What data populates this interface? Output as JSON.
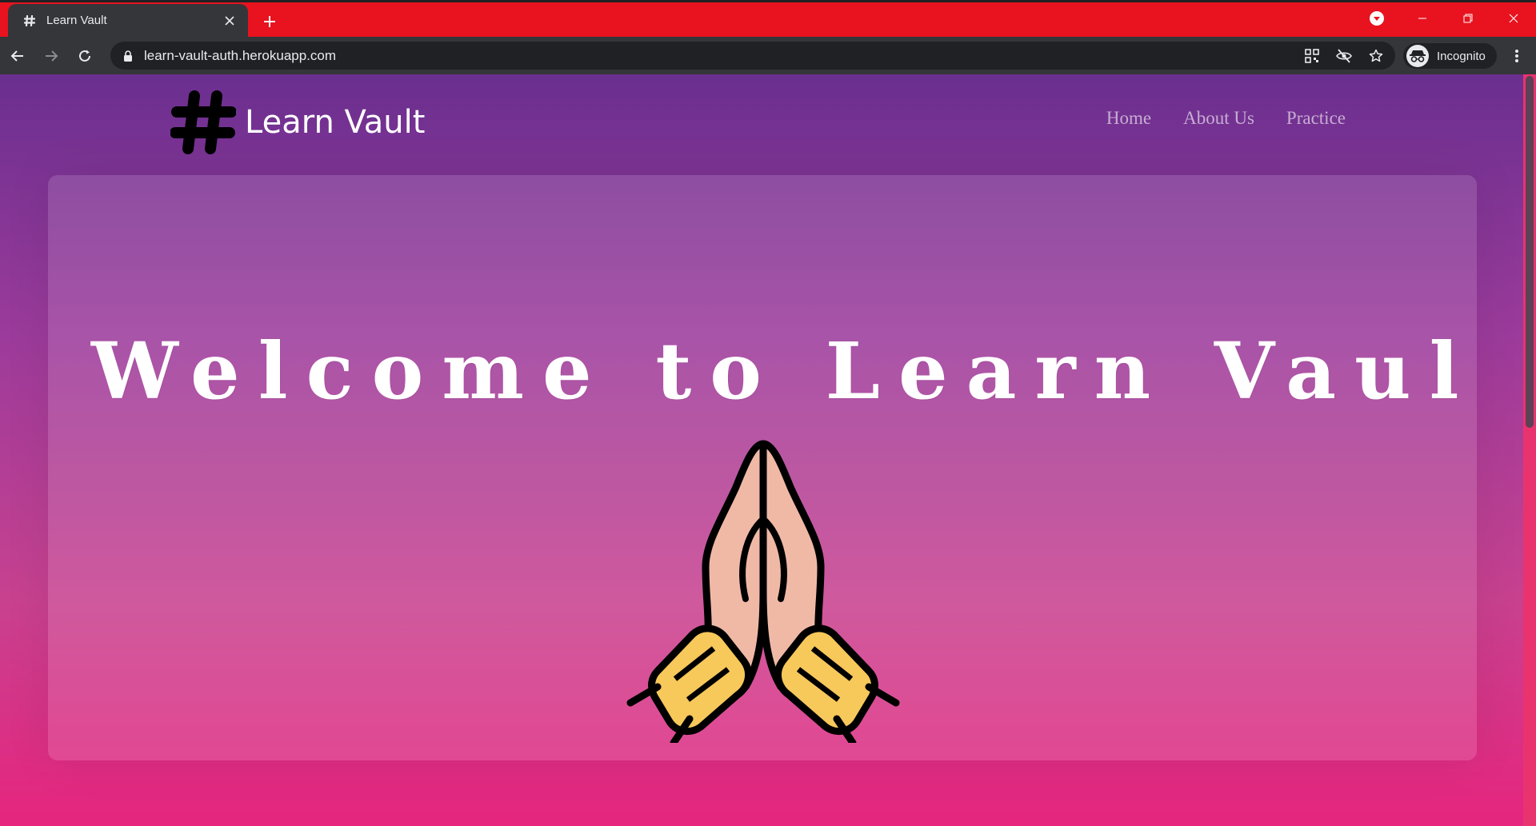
{
  "browser": {
    "tab_title": "Learn Vault",
    "url": "learn-vault-auth.herokuapp.com",
    "profile_label": "Incognito",
    "accent_color": "#e8131f"
  },
  "site": {
    "brand_name": "Learn Vault",
    "nav": [
      {
        "label": "Home"
      },
      {
        "label": "About Us"
      },
      {
        "label": "Practice"
      }
    ]
  },
  "hero": {
    "title": "Welcome to Learn Vault",
    "title_icon": "laptop-icon",
    "illustration": "praying-hands-icon"
  }
}
